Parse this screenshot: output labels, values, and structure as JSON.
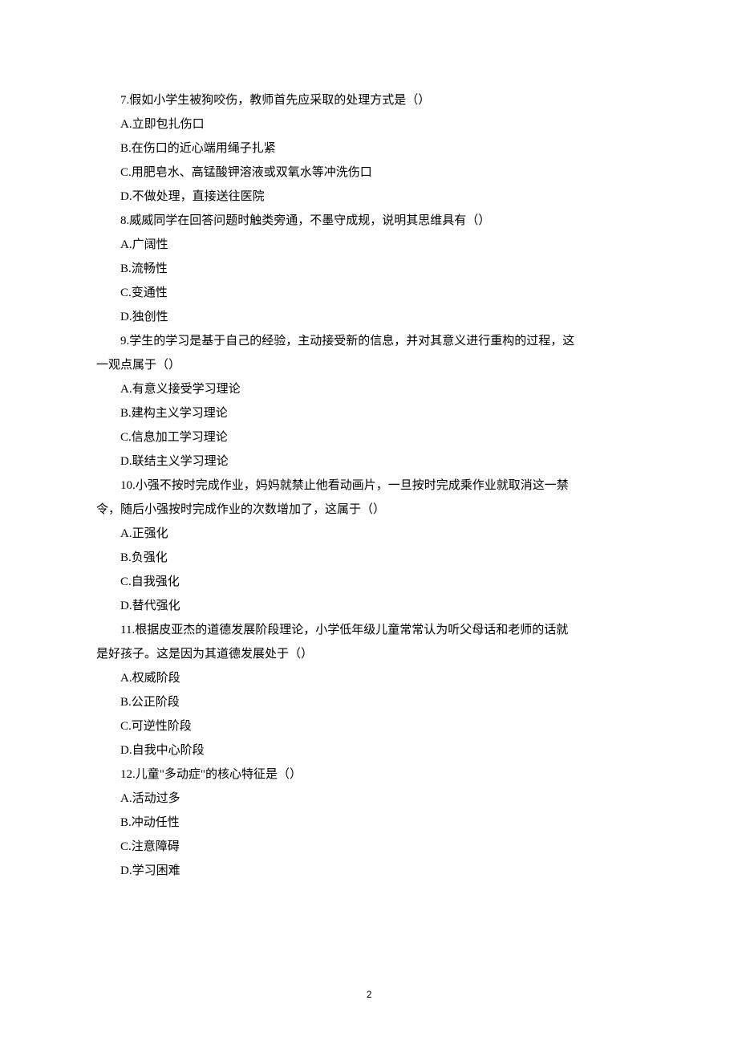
{
  "q7": {
    "text": "7.假如小学生被狗咬伤，教师首先应采取的处理方式是（）",
    "optA": "A.立即包扎伤口",
    "optB": "B.在伤口的近心端用绳子扎紧",
    "optC": "C.用肥皂水、高锰酸钾溶液或双氧水等冲洗伤口",
    "optD": "D.不做处理，直接送往医院"
  },
  "q8": {
    "text": "8.威威同学在回答问题时触类旁通，不墨守成规，说明其思维具有（）",
    "optA": "A.广阔性",
    "optB": "B.流畅性",
    "optC": "C.变通性",
    "optD": "D.独创性"
  },
  "q9": {
    "line1": "9.学生的学习是基于自己的经验，主动接受新的信息，并对其意义进行重构的过程，这",
    "line2": "一观点属于（）",
    "optA": "A.有意义接受学习理论",
    "optB": "B.建构主义学习理论",
    "optC": "C.信息加工学习理论",
    "optD": "D.联结主义学习理论"
  },
  "q10": {
    "line1": "10.小强不按时完成作业，妈妈就禁止他看动画片，一旦按时完成乘作业就取消这一禁",
    "line2": "令，随后小强按时完成作业的次数增加了，这属于（）",
    "optA": "A.正强化",
    "optB": "B.负强化",
    "optC": "C.自我强化",
    "optD": "D.替代强化"
  },
  "q11": {
    "line1": "11.根据皮亚杰的道德发展阶段理论，小学低年级儿童常常认为听父母话和老师的话就",
    "line2": "是好孩子。这是因为其道德发展处于（）",
    "optA": "A.权威阶段",
    "optB": "B.公正阶段",
    "optC": "C.可逆性阶段",
    "optD": "D.自我中心阶段"
  },
  "q12": {
    "text": "12.儿童\"多动症\"的核心特征是（）",
    "optA": "A.活动过多",
    "optB": "B.冲动任性",
    "optC": "C.注意障碍",
    "optD": "D.学习困难"
  },
  "pageNumber": "2"
}
